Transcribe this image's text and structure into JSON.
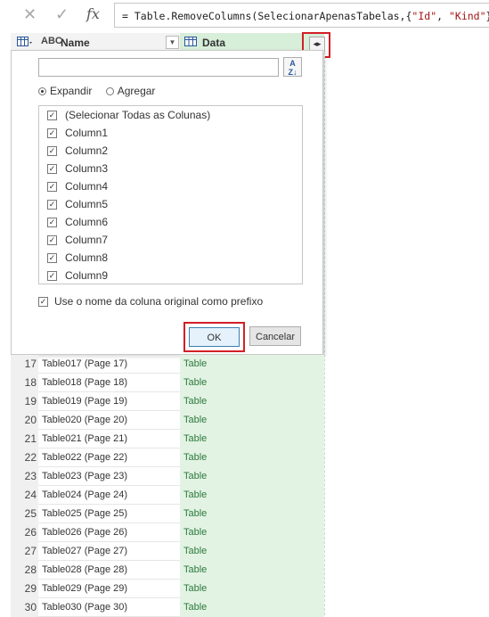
{
  "formula_bar": {
    "cancel_icon": "close-icon",
    "confirm_icon": "check-icon",
    "fx_label": "fx",
    "formula_prefix": "= Table.RemoveColumns(SelecionarApenasTabelas,{",
    "formula_str1": "\"Id\"",
    "formula_sep": ", ",
    "formula_str2": "\"Kind\"",
    "formula_suffix": "})"
  },
  "columns": {
    "name_type": "ABC",
    "name_label": "Name",
    "data_label": "Data"
  },
  "expand_dialog": {
    "search_value": "",
    "sort_label": "A↓Z",
    "radio_expand": "Expandir",
    "radio_aggregate": "Agregar",
    "selected_radio": "Expandir",
    "items": [
      {
        "label": "(Selecionar Todas as Colunas)",
        "checked": true
      },
      {
        "label": "Column1",
        "checked": true
      },
      {
        "label": "Column2",
        "checked": true
      },
      {
        "label": "Column3",
        "checked": true
      },
      {
        "label": "Column4",
        "checked": true
      },
      {
        "label": "Column5",
        "checked": true
      },
      {
        "label": "Column6",
        "checked": true
      },
      {
        "label": "Column7",
        "checked": true
      },
      {
        "label": "Column8",
        "checked": true
      },
      {
        "label": "Column9",
        "checked": true
      }
    ],
    "prefix_label": "Use o nome da coluna original como prefixo",
    "prefix_checked": true,
    "ok_label": "OK",
    "cancel_label": "Cancelar"
  },
  "rows": [
    {
      "num": "17",
      "name": "Table017 (Page 17)",
      "data": "Table"
    },
    {
      "num": "18",
      "name": "Table018 (Page 18)",
      "data": "Table"
    },
    {
      "num": "19",
      "name": "Table019 (Page 19)",
      "data": "Table"
    },
    {
      "num": "20",
      "name": "Table020 (Page 20)",
      "data": "Table"
    },
    {
      "num": "21",
      "name": "Table021 (Page 21)",
      "data": "Table"
    },
    {
      "num": "22",
      "name": "Table022 (Page 22)",
      "data": "Table"
    },
    {
      "num": "23",
      "name": "Table023 (Page 23)",
      "data": "Table"
    },
    {
      "num": "24",
      "name": "Table024 (Page 24)",
      "data": "Table"
    },
    {
      "num": "25",
      "name": "Table025 (Page 25)",
      "data": "Table"
    },
    {
      "num": "26",
      "name": "Table026 (Page 26)",
      "data": "Table"
    },
    {
      "num": "27",
      "name": "Table027 (Page 27)",
      "data": "Table"
    },
    {
      "num": "28",
      "name": "Table028 (Page 28)",
      "data": "Table"
    },
    {
      "num": "29",
      "name": "Table029 (Page 29)",
      "data": "Table"
    },
    {
      "num": "30",
      "name": "Table030 (Page 30)",
      "data": "Table"
    }
  ],
  "colors": {
    "highlight": "#d21f26",
    "data_column": "#e2f3e4",
    "data_text": "#2d7a3b"
  }
}
